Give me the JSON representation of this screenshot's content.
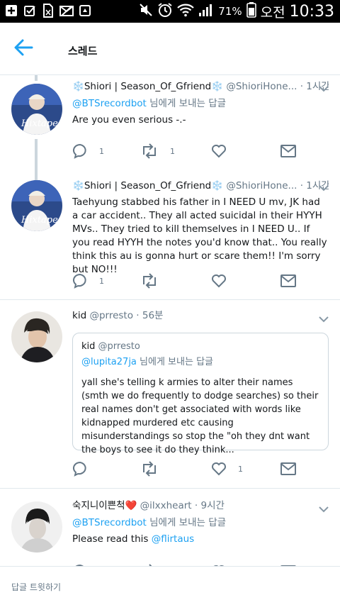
{
  "status_bar": {
    "battery_percent": "71%",
    "ampm": "오전",
    "time": "10:33"
  },
  "header": {
    "title": "스레드",
    "back_icon": "arrow-left-icon"
  },
  "tweets": [
    {
      "name": "Shiori | Season_Of_Gfriend",
      "name_emoji": "❄️",
      "handle": "@ShioriHone...",
      "time": "1시간",
      "reply_to_handle": "@BTSrecordbot",
      "reply_to_suffix": " 님에게 보내는 답글",
      "text": "Are you even serious -.-",
      "reply_count": "1",
      "retweet_count": "1",
      "like_count": ""
    },
    {
      "name": "Shiori | Season_Of_Gfriend",
      "name_emoji": "❄️",
      "handle": "@ShioriHone...",
      "time": "1시간",
      "text": "Taehyung stabbed his father in I NEED U mv, JK had a car accident.. They all acted suicidal in their HYYH MVs.. They tried to kill themselves in I NEED U.. If you read HYYH the notes you'd know that.. You really think this au is gonna hurt or scare them!! I'm sorry but NO!!!",
      "reply_count": "1",
      "retweet_count": "",
      "like_count": ""
    },
    {
      "name": "kid",
      "handle": "@prresto",
      "time": "56분",
      "quote": {
        "name": "kid",
        "handle": "@prresto",
        "reply_to_handle": "@lupita27ja",
        "reply_to_suffix": " 님에게 보내는 답글",
        "text": "yall she's telling k armies to alter their names (smth we do frequently to dodge searches) so their real names don't get associated with words like kidnapped murdered etc causing misunderstandings so stop the \"oh they dnt want the boys to see it do they think..."
      },
      "reply_count": "",
      "retweet_count": "",
      "like_count": "1"
    },
    {
      "name": "숙지니이쁜척",
      "name_emoji": "❤️",
      "handle": "@ilxxheart",
      "time": "9시간",
      "reply_to_handle": "@BTSrecordbot",
      "reply_to_suffix": " 님에게 보내는 답글",
      "text_prefix": "Please read this ",
      "text_mention": "@flirtaus"
    }
  ],
  "reply_bar": {
    "placeholder": "답글 트윗하기"
  },
  "colors": {
    "accent": "#1da1f2",
    "secondary_text": "#657786",
    "thread_line": "#ccd6dd",
    "divider": "#e1e8ed"
  }
}
